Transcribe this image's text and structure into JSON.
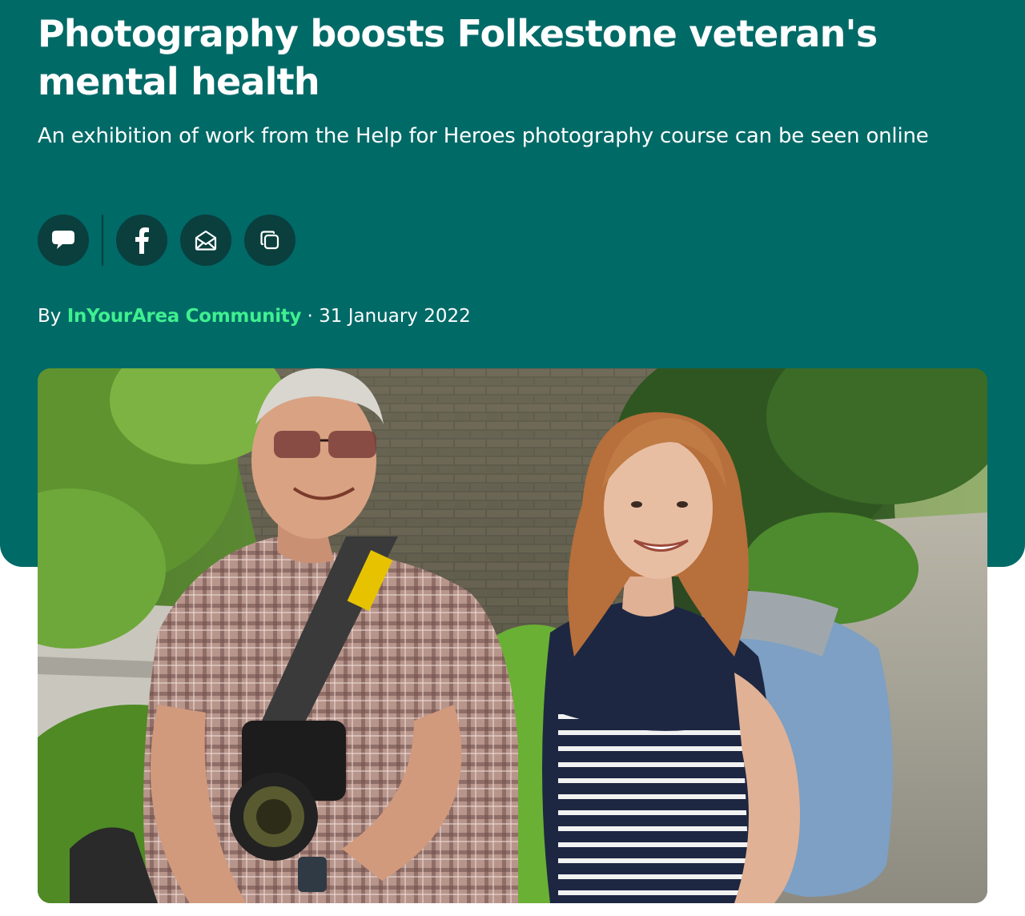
{
  "article": {
    "headline": "Photography boosts Folkestone veteran's mental health",
    "standfirst": "An exhibition of work from the Help for Heroes photography course can be seen online",
    "byline": {
      "prefix": "By ",
      "author": "InYourArea Community",
      "separator": " · ",
      "date": "31 January 2022"
    }
  },
  "share": {
    "buttons": [
      {
        "icon": "comment-icon"
      },
      {
        "icon": "facebook-icon"
      },
      {
        "icon": "email-icon"
      },
      {
        "icon": "copy-link-icon"
      }
    ]
  },
  "colors": {
    "header_bg": "#006a67",
    "button_bg": "#0a3f3d",
    "author_link": "#3ff08f",
    "text": "#ffffff"
  }
}
